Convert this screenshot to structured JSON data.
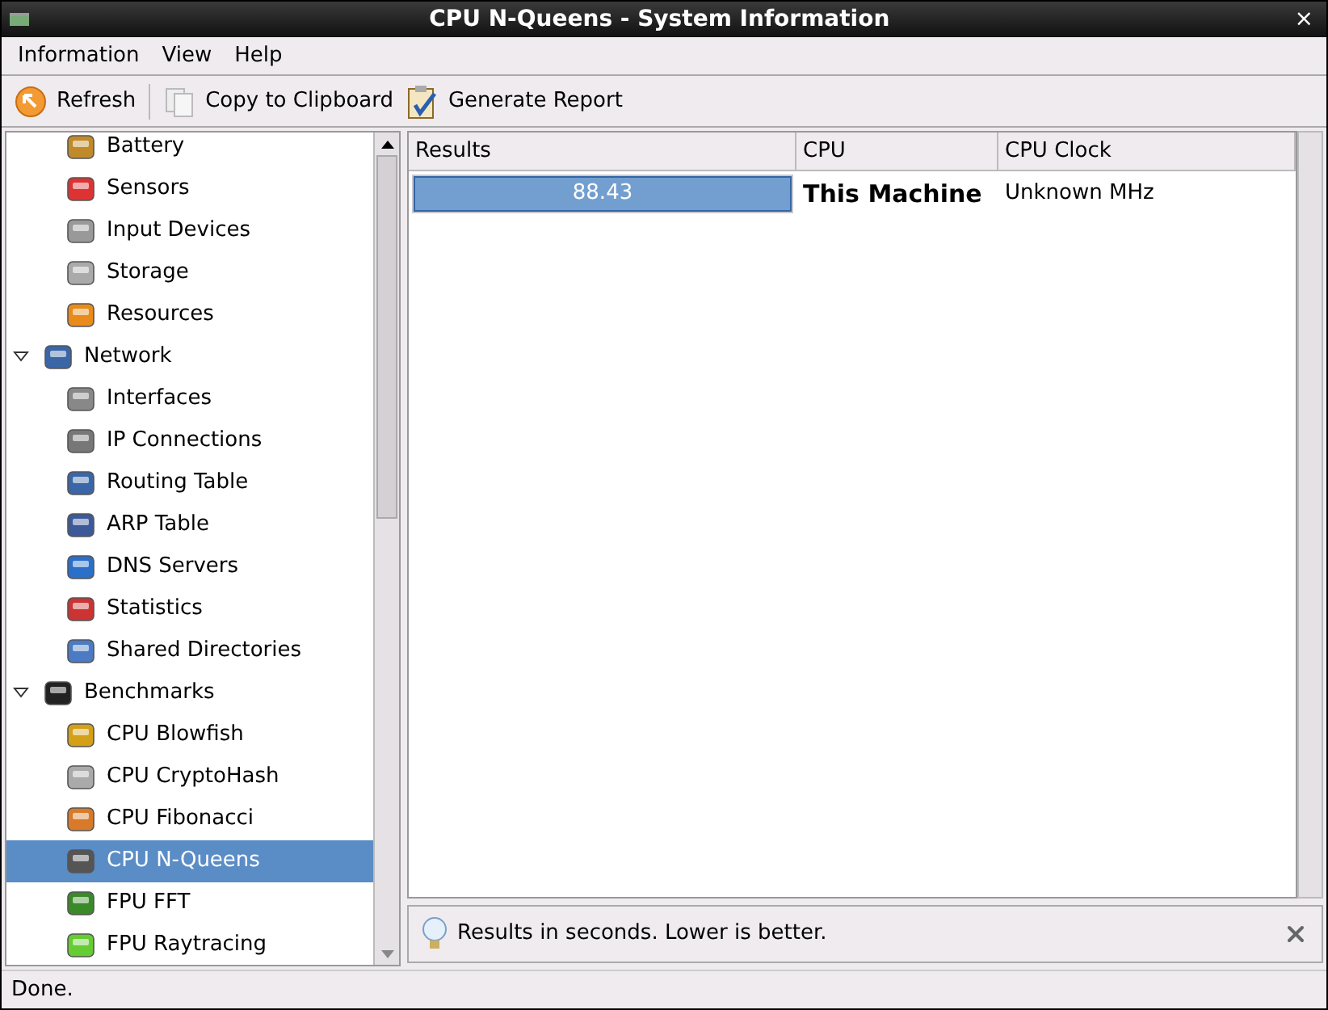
{
  "window": {
    "title": "CPU N-Queens - System Information",
    "close": "×"
  },
  "menu": [
    {
      "label": "Information",
      "selected": false
    },
    {
      "label": "View",
      "selected": false
    },
    {
      "label": "Help",
      "selected": false
    }
  ],
  "toolbar": [
    {
      "label": "Refresh",
      "kind": "refresh"
    },
    {
      "label": "Copy to Clipboard",
      "kind": "copy"
    },
    {
      "label": "Generate Report",
      "kind": "report"
    }
  ],
  "sidebar": {
    "items": [
      {
        "kind": "leaf",
        "label": "Battery",
        "selected": false
      },
      {
        "kind": "leaf",
        "label": "Sensors",
        "selected": false
      },
      {
        "kind": "leaf",
        "label": "Input Devices",
        "selected": false
      },
      {
        "kind": "leaf",
        "label": "Storage",
        "selected": false
      },
      {
        "kind": "leaf",
        "label": "Resources",
        "selected": false
      },
      {
        "kind": "group",
        "label": "Network",
        "selected": false,
        "expanded": true,
        "children": [
          {
            "label": "Interfaces",
            "selected": false
          },
          {
            "label": "IP Connections",
            "selected": false
          },
          {
            "label": "Routing Table",
            "selected": false
          },
          {
            "label": "ARP Table",
            "selected": false
          },
          {
            "label": "DNS Servers",
            "selected": false
          },
          {
            "label": "Statistics",
            "selected": false
          },
          {
            "label": "Shared Directories",
            "selected": false
          }
        ]
      },
      {
        "kind": "group",
        "label": "Benchmarks",
        "selected": false,
        "expanded": true,
        "children": [
          {
            "label": "CPU Blowfish",
            "selected": false
          },
          {
            "label": "CPU CryptoHash",
            "selected": false
          },
          {
            "label": "CPU Fibonacci",
            "selected": false
          },
          {
            "label": "CPU N-Queens",
            "selected": true
          },
          {
            "label": "FPU FFT",
            "selected": false
          },
          {
            "label": "FPU Raytracing",
            "selected": false
          }
        ]
      }
    ]
  },
  "table": {
    "columns": [
      "Results",
      "CPU",
      "CPU Clock"
    ],
    "rows": [
      {
        "result": "88.43",
        "level": 1,
        "cpu": "This Machine",
        "clock": "Unknown MHz"
      }
    ]
  },
  "info_bar": {
    "text": "Results in seconds. Lower is better."
  },
  "status_bar": "Done."
}
